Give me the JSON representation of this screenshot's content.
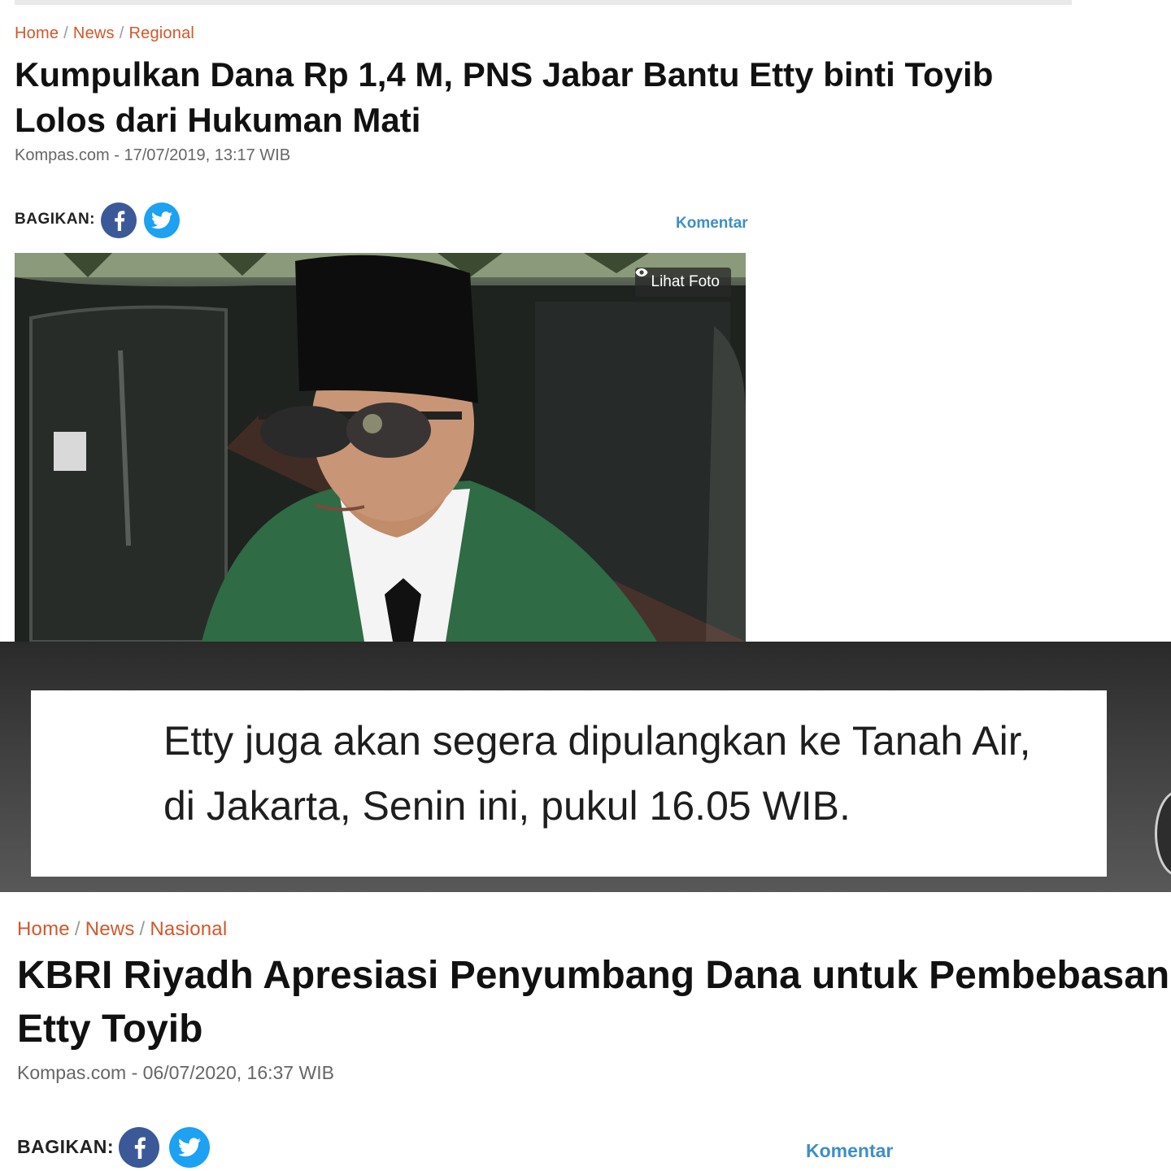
{
  "article1": {
    "breadcrumb": [
      "Home",
      "News",
      "Regional"
    ],
    "title": "Kumpulkan Dana Rp 1,4 M, PNS Jabar Bantu Etty binti Toyib Lolos dari Hukuman Mati",
    "meta": "Kompas.com - 17/07/2019, 13:17 WIB",
    "share_label": "BAGIKAN:",
    "comment_label": "Komentar",
    "photo_button": "Lihat Foto"
  },
  "quote": {
    "line1": "Etty juga akan segera dipulangkan ke Tanah Air,",
    "line2": "di Jakarta, Senin ini, pukul 16.05 WIB."
  },
  "article2": {
    "breadcrumb": [
      "Home",
      "News",
      "Nasional"
    ],
    "title_line1": "KBRI Riyadh Apresiasi Penyumbang Dana untuk Pembebasan T",
    "title_line2": "Etty Toyib",
    "meta": "Kompas.com - 06/07/2020, 16:37 WIB",
    "share_label": "BAGIKAN:",
    "comment_label": "Komentar"
  },
  "colors": {
    "breadcrumb": "#d2572a",
    "comment": "#3d8fc7",
    "facebook": "#3b5998",
    "twitter": "#1da1f2"
  },
  "icons": [
    "facebook-icon",
    "twitter-icon",
    "eye-icon"
  ]
}
